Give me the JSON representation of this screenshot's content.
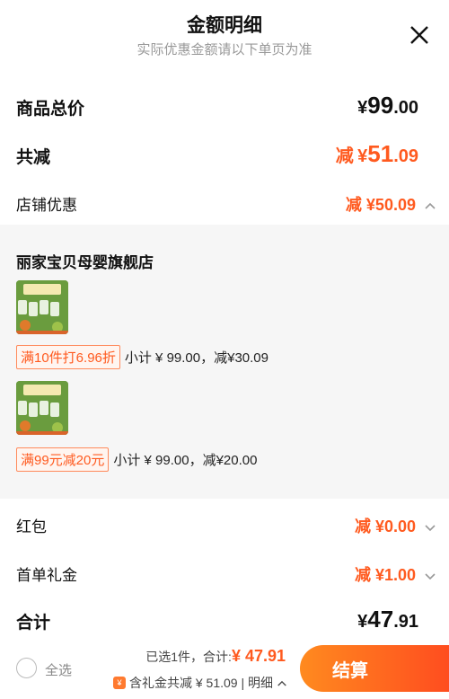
{
  "header": {
    "title": "金额明细",
    "subtitle": "实际优惠金额请以下单页为准"
  },
  "summary": {
    "total_label": "商品总价",
    "total_amount": {
      "sym": "¥",
      "int": "99",
      "dec": ".00"
    },
    "reduce_label": "共减",
    "reduce_amount": {
      "prefix": "减",
      "sym": "¥",
      "int": "51",
      "dec": ".09"
    },
    "store_discount_label": "店铺优惠",
    "store_discount_amount": "减 ¥50.09"
  },
  "store": {
    "name": "丽家宝贝母婴旗舰店",
    "items": [
      {
        "promo_tag": "满10件打6.96折",
        "promo_text": "小计 ¥ 99.00，减¥30.09"
      },
      {
        "promo_tag": "满99元减20元",
        "promo_text": "小计 ¥ 99.00，减¥20.00"
      }
    ]
  },
  "others": {
    "red_packet_label": "红包",
    "red_packet_amount": "减 ¥0.00",
    "first_order_label": "首单礼金",
    "first_order_amount": "减 ¥1.00",
    "sum_label": "合计",
    "sum_amount": {
      "sym": "¥",
      "int": "47",
      "dec": ".91"
    }
  },
  "footer": {
    "select_all": "全选",
    "selected_prefix": "已选1件，合计:",
    "selected_total": "¥ 47.91",
    "discount_text": "含礼金共减 ¥ 51.09 | 明细",
    "checkout_label": "结算"
  },
  "colors": {
    "accent": "#ff5a1f",
    "panel_bg": "#f6f6f6"
  }
}
